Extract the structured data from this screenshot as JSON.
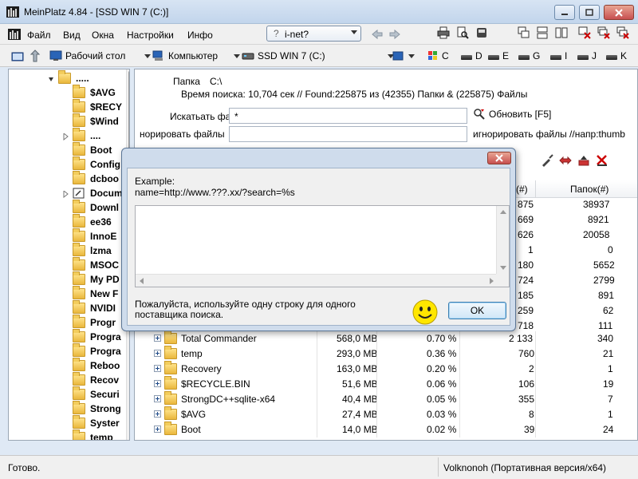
{
  "window": {
    "title": "MeinPlatz 4.84 - [SSD WIN 7 (C:)]"
  },
  "menu": {
    "items": [
      "Файл",
      "Вид",
      "Окна",
      "Настройки",
      "Инфо"
    ],
    "inet_combo": "i-net?"
  },
  "toolbar2": {
    "desktop": "Рабочий стол",
    "computer": "Компьютер",
    "drive": "SSD WIN 7 (C:)",
    "drive_letters": [
      "C",
      "D",
      "E",
      "G",
      "I",
      "J",
      "K"
    ]
  },
  "tree": {
    "items": [
      ".....",
      "$AVG",
      "$RECY",
      "$Wind",
      "....",
      "Boot",
      "Config",
      "dcboo",
      "Docum",
      "Downl",
      "ee36",
      "InnoE",
      "lzma",
      "MSOC",
      "My PD",
      "New F",
      "NVIDI",
      "Progr",
      "Progra",
      "Progra",
      "Reboo",
      "Recov",
      "Securi",
      "Strong",
      "Syster",
      "temp"
    ]
  },
  "search": {
    "folder_label": "Папка",
    "folder_value": "C:\\",
    "summary": "Время поиска: 10,704 сек //  Found:225875 из (42355) Папки & (225875) Файлы",
    "search_label": "Искатьать файлы",
    "search_value": "*",
    "refresh_label": "Обновить [F5]",
    "ignore_label": "норировать файлы",
    "ignore_value": "",
    "ignore_hint": "игнорировать файлы //напр:thumb"
  },
  "list": {
    "headers": [
      "(#)",
      "Папок(#)"
    ],
    "partial_rows": [
      [
        "875",
        "38937"
      ],
      [
        "669",
        "8921"
      ],
      [
        "626",
        "20058"
      ],
      [
        "1",
        "0"
      ],
      [
        "180",
        "5652"
      ],
      [
        "724",
        "2799"
      ],
      [
        "185",
        "891"
      ],
      [
        "259",
        "62"
      ],
      [
        "718",
        "111"
      ]
    ],
    "rows": [
      {
        "name": "Total Commander",
        "size": "568,0 MB",
        "pct": "0.70 %",
        "files": "2 133",
        "folders": "340"
      },
      {
        "name": "temp",
        "size": "293,0 MB",
        "pct": "0.36 %",
        "files": "760",
        "folders": "21"
      },
      {
        "name": "Recovery",
        "size": "163,0 MB",
        "pct": "0.20 %",
        "files": "2",
        "folders": "1"
      },
      {
        "name": "$RECYCLE.BIN",
        "size": "51,6 MB",
        "pct": "0.06 %",
        "files": "106",
        "folders": "19"
      },
      {
        "name": "StrongDC++sqlite-x64",
        "size": "40,4 MB",
        "pct": "0.05 %",
        "files": "355",
        "folders": "7"
      },
      {
        "name": "$AVG",
        "size": "27,4 MB",
        "pct": "0.03 %",
        "files": "8",
        "folders": "1"
      },
      {
        "name": "Boot",
        "size": "14,0 MB",
        "pct": "0.02 %",
        "files": "39",
        "folders": "24"
      }
    ]
  },
  "dialog": {
    "example_label": "Example:",
    "example_value": "name=http://www.???.xx/?search=%s",
    "hint": "Пожалуйста, используйте одну строку для одного поставщика поиска.",
    "ok": "OK"
  },
  "status": {
    "left": "Готово.",
    "right": "Volknonoh (Портативная версия/x64)"
  }
}
